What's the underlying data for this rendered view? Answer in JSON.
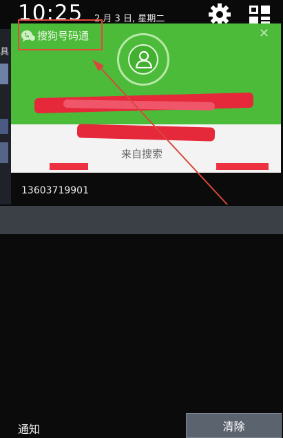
{
  "status_bar": {
    "time": "10:25",
    "date": "2 月 3 日, 星期二",
    "settings_icon": "gear-icon",
    "quick_settings_icon": "quick-settings-icon"
  },
  "left_strip": {
    "text": "具"
  },
  "notification": {
    "app_name": "搜狗号码通",
    "app_icon": "phone-bubble-icon",
    "close_icon": "close-icon",
    "avatar_icon": "person-icon",
    "source": "来自搜索",
    "phone_number": "13603719901"
  },
  "bottom_bar": {
    "label": "通知",
    "clear_label": "清除"
  },
  "colors": {
    "card_green": "#4dbb3a",
    "annotation_red": "#e24a3c"
  }
}
